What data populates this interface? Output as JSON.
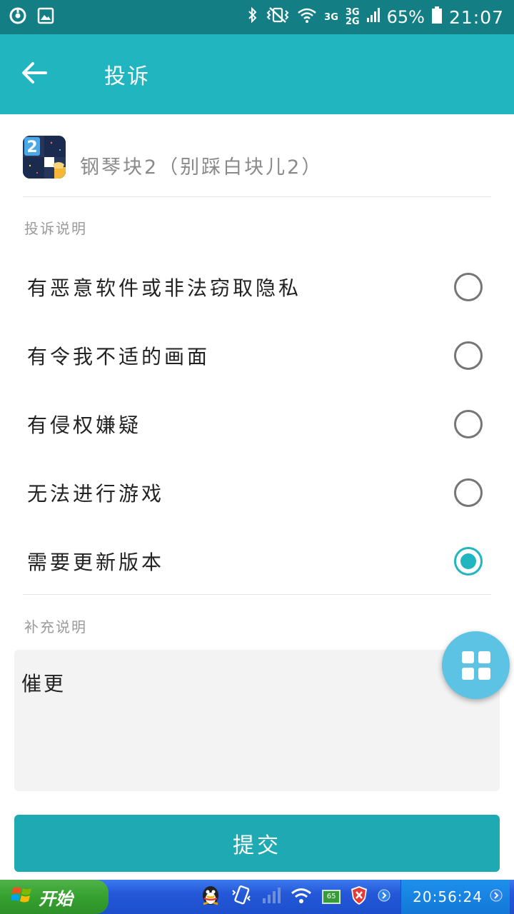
{
  "status_bar": {
    "net_3g": "3G",
    "net_3g2": "3G",
    "net_2g": "2G",
    "battery": "65%",
    "time": "21:07"
  },
  "app_bar": {
    "title": "投诉"
  },
  "app": {
    "name": "钢琴块2（别踩白块儿2）",
    "icon_badge": "2"
  },
  "section_complaint": "投诉说明",
  "options": [
    {
      "label": "有恶意软件或非法窃取隐私",
      "checked": false
    },
    {
      "label": "有令我不适的画面",
      "checked": false
    },
    {
      "label": "有侵权嫌疑",
      "checked": false
    },
    {
      "label": "无法进行游戏",
      "checked": false
    },
    {
      "label": "需要更新版本",
      "checked": true
    }
  ],
  "section_supplement": "补充说明",
  "supplement_text": "催更",
  "submit_label": "提交",
  "taskbar": {
    "start_label": "开始",
    "clock": "20:56:24",
    "tray_badge": "65"
  },
  "colors": {
    "status_bar": "#137f85",
    "app_bar": "#20b5bf",
    "submit": "#1fa9b3",
    "fab": "#5cc3e4",
    "radio_checked": "#20b5bf"
  }
}
